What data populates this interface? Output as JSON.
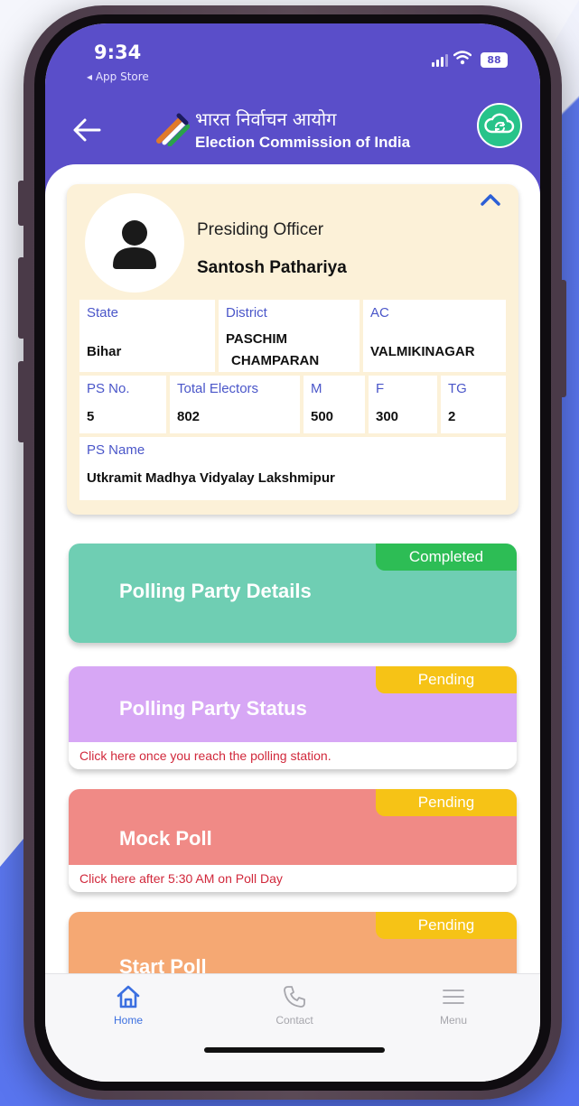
{
  "status_bar": {
    "time": "9:34",
    "back_app": "◂ App Store",
    "battery": "88"
  },
  "header": {
    "title_hindi": "भारत निर्वाचन आयोग",
    "title_english": "Election Commission of India"
  },
  "officer": {
    "role": "Presiding Officer",
    "name": "Santosh Pathariya",
    "fields": {
      "state_label": "State",
      "state_value": "Bihar",
      "district_label": "District",
      "district_value_line1": "PASCHIM",
      "district_value_line2": "CHAMPARAN",
      "ac_label": "AC",
      "ac_value": "VALMIKINAGAR",
      "ps_no_label": "PS No.",
      "ps_no_value": "5",
      "total_electors_label": "Total Electors",
      "total_electors_value": "802",
      "m_label": "M",
      "m_value": "500",
      "f_label": "F",
      "f_value": "300",
      "tg_label": "TG",
      "tg_value": "2",
      "ps_name_label": "PS Name",
      "ps_name_value": "Utkramit Madhya Vidyalay Lakshmipur"
    }
  },
  "tasks": [
    {
      "title": "Polling Party Details",
      "status": "Completed",
      "note": "",
      "color": "#6fceb3",
      "badge_color": "#2dbd55"
    },
    {
      "title": "Polling Party Status",
      "status": "Pending",
      "note": "Click here once you reach the polling station.",
      "color": "#d7a7f5",
      "badge_color": "#f6c316"
    },
    {
      "title": "Mock Poll",
      "status": "Pending",
      "note": "Click here after 5:30 AM on Poll Day",
      "color": "#f08a86",
      "badge_color": "#f6c316"
    },
    {
      "title": "Start Poll",
      "status": "Pending",
      "note": "",
      "color": "#f5a873",
      "badge_color": "#f6c316"
    }
  ],
  "tabbar": {
    "home": {
      "label": "Home",
      "icon": "home-icon",
      "color": "#3b6fe0"
    },
    "contact": {
      "label": "Contact",
      "icon": "phone-icon",
      "color": "#a6a6ac"
    },
    "menu": {
      "label": "Menu",
      "icon": "menu-icon",
      "color": "#a6a6ac"
    }
  },
  "colors": {
    "header": "#5a4ec9",
    "label_blue": "#4a56c9",
    "note_red": "#d1283b"
  }
}
